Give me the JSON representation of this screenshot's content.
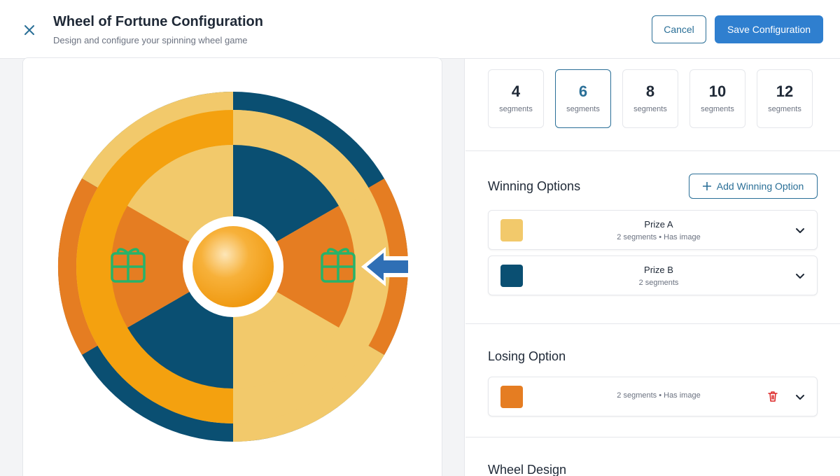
{
  "header": {
    "title": "Wheel of Fortune Configuration",
    "subtitle": "Design and configure your spinning wheel game",
    "cancel_label": "Cancel",
    "save_label": "Save Configuration"
  },
  "segment_counts": [
    {
      "value": "4",
      "label": "segments",
      "selected": false
    },
    {
      "value": "6",
      "label": "segments",
      "selected": true
    },
    {
      "value": "8",
      "label": "segments",
      "selected": false
    },
    {
      "value": "10",
      "label": "segments",
      "selected": false
    },
    {
      "value": "12",
      "label": "segments",
      "selected": false
    }
  ],
  "winning": {
    "title": "Winning Options",
    "add_label": "Add Winning Option",
    "options": [
      {
        "name": "Prize A",
        "meta": "2 segments • Has image",
        "color": "#f2c96b"
      },
      {
        "name": "Prize B",
        "meta": "2 segments",
        "color": "#0a4f72"
      }
    ]
  },
  "losing": {
    "title": "Losing Option",
    "option": {
      "meta": "2 segments • Has image",
      "color": "#e57d22"
    }
  },
  "wheel_design": {
    "title": "Wheel Design"
  },
  "colors": {
    "accent": "#2a6f97",
    "primary_button": "#2f7fcf",
    "wheel_gold": "#f2c96b",
    "wheel_navy": "#0a4f72",
    "wheel_orange": "#e57d22",
    "wheel_rim_orange": "#f4a10f",
    "gift_icon": "#26b36a",
    "pointer": "#2f6fb5"
  }
}
